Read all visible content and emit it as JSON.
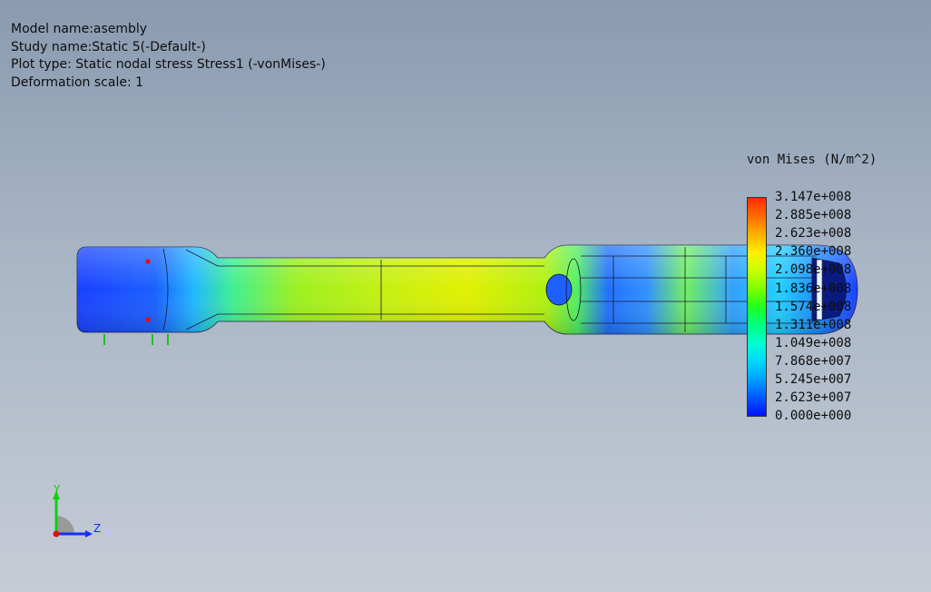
{
  "info": {
    "model_name": "Model name:asembly",
    "study_name": "Study name:Static 5(-Default-)",
    "plot_type": "Plot type: Static nodal stress Stress1 (-vonMises-)",
    "deformation": "Deformation scale: 1"
  },
  "legend": {
    "title": "von Mises (N/m^2)",
    "ticks": [
      "3.147e+008",
      "2.885e+008",
      "2.623e+008",
      "2.360e+008",
      "2.098e+008",
      "1.836e+008",
      "1.574e+008",
      "1.311e+008",
      "1.049e+008",
      "7.868e+007",
      "5.245e+007",
      "2.623e+007",
      "0.000e+000"
    ],
    "colors": [
      "#ff2a00",
      "#ff6a00",
      "#ffb000",
      "#ffee00",
      "#c8ff00",
      "#7dff00",
      "#20ff20",
      "#00ff80",
      "#00ffd0",
      "#00d8ff",
      "#00a0ff",
      "#0058ff",
      "#0010ff"
    ]
  },
  "triad": {
    "y_label": "Y",
    "z_label": "Z"
  },
  "colors": {
    "background_top": "#8a9bb0",
    "background_bottom": "#c6ccd6"
  }
}
